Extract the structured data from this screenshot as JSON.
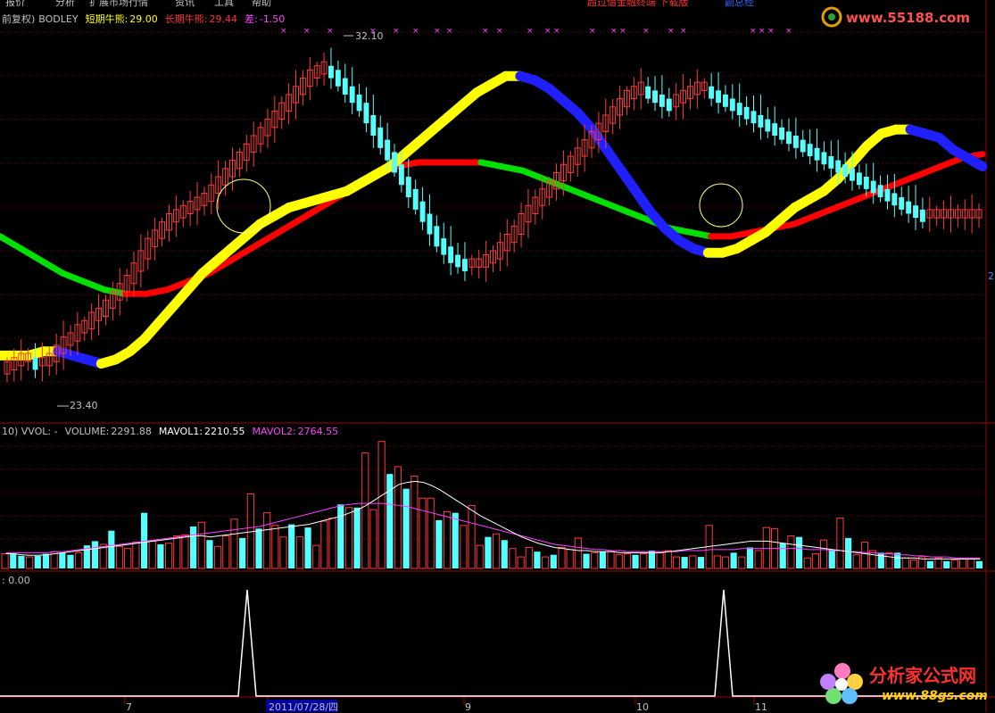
{
  "menu": {
    "items": [
      "报价",
      "分析",
      "扩展市场行情",
      "资讯",
      "工具",
      "帮助"
    ],
    "promo": "超过借金融终端 下载版",
    "promo2": "副总经"
  },
  "watermark_top": "www.55188.com",
  "watermark_bottom": {
    "cn": "分析家公式网",
    "url": "www.88gs.com"
  },
  "panels": {
    "price": {
      "label_prefix": "前复权)",
      "indicator": "BODLEY",
      "short_label": "短期牛熊:",
      "short_value": "29.00",
      "long_label": "长期牛熊:",
      "long_value": "29.44",
      "diff_label": "差:",
      "diff_value": "-1.50",
      "high_annotation": "32.10",
      "low_annotation": "23.40",
      "right_axis_label": "2"
    },
    "volume": {
      "label_prefix": "10) VVOL: -",
      "volume_label": "VOLUME:",
      "volume_value": "2291.88",
      "mavol1_label": "MAVOL1:",
      "mavol1_value": "2210.55",
      "mavol2_label": "MAVOL2:",
      "mavol2_value": "2764.55"
    },
    "signal": {
      "label": ": 0.00"
    }
  },
  "x_axis": {
    "ticks": [
      {
        "label": "7",
        "index": 0
      },
      {
        "label": "2011/07/28/四",
        "index": 27,
        "highlight": true
      },
      {
        "label": "9",
        "index": 66
      },
      {
        "label": "10",
        "index": 91
      },
      {
        "label": "11",
        "index": 108
      }
    ]
  },
  "colors": {
    "up": "#ff3b3b",
    "down": "#54ffff",
    "short_rising": "#ffff00",
    "short_falling": "#2020ff",
    "long_rising": "#ff0000",
    "long_falling": "#00e000",
    "mavol1": "#ffffff",
    "mavol2": "#ff40ff",
    "grid": "#7a0000",
    "signal": "#ffffff",
    "marker": "#ff40ff"
  },
  "chart_data": [
    {
      "type": "candlestick",
      "title": "BODLEY",
      "ylim": [
        23.0,
        32.6
      ],
      "x": [
        0,
        1,
        2,
        3,
        4,
        5,
        6,
        7,
        8,
        9,
        10,
        11,
        12,
        13,
        14,
        15,
        16,
        17,
        18,
        19,
        20,
        21,
        22,
        23,
        24,
        25,
        26,
        27,
        28,
        29,
        30,
        31,
        32,
        33,
        34,
        35,
        36,
        37,
        38,
        39,
        40,
        41,
        42,
        43,
        44,
        45,
        46,
        47,
        48,
        49,
        50,
        51,
        52,
        53,
        54,
        55,
        56,
        57,
        58,
        59,
        60,
        61,
        62,
        63,
        64,
        65,
        66,
        67,
        68,
        69,
        70,
        71,
        72,
        73,
        74,
        75,
        76,
        77,
        78,
        79,
        80,
        81,
        82,
        83,
        84,
        85,
        86,
        87,
        88,
        89,
        90,
        91,
        92,
        93,
        94,
        95,
        96,
        97,
        98,
        99,
        100,
        101,
        102,
        103,
        104,
        105,
        106,
        107,
        108,
        109,
        110,
        111,
        112,
        113,
        114,
        115,
        116,
        117,
        118,
        119,
        120,
        121,
        122,
        123,
        124,
        125,
        126,
        127,
        128,
        129,
        130,
        131,
        132,
        133,
        134,
        135,
        136,
        137,
        138
      ],
      "open": [
        24.2,
        24.3,
        24.4,
        24.5,
        24.5,
        24.4,
        24.4,
        24.5,
        24.7,
        24.9,
        25.0,
        25.2,
        25.3,
        25.5,
        25.6,
        25.8,
        26.0,
        26.2,
        26.4,
        26.7,
        27.0,
        27.3,
        27.5,
        27.7,
        27.9,
        28.0,
        28.1,
        28.2,
        28.3,
        28.4,
        28.6,
        28.8,
        29.0,
        29.2,
        29.4,
        29.6,
        29.8,
        30.0,
        30.2,
        30.4,
        30.6,
        30.8,
        31.0,
        31.2,
        31.4,
        31.5,
        31.6,
        31.5,
        31.3,
        31.1,
        30.9,
        30.7,
        30.4,
        30.1,
        29.8,
        29.5,
        29.2,
        28.9,
        28.6,
        28.3,
        28.0,
        27.7,
        27.4,
        27.2,
        27.0,
        26.9,
        26.8,
        26.8,
        26.8,
        26.9,
        27.0,
        27.2,
        27.4,
        27.6,
        27.9,
        28.1,
        28.3,
        28.5,
        28.7,
        28.9,
        29.1,
        29.3,
        29.5,
        29.7,
        29.9,
        30.1,
        30.3,
        30.5,
        30.7,
        30.9,
        31.0,
        31.1,
        31.0,
        30.9,
        30.8,
        30.7,
        30.8,
        30.9,
        31.0,
        31.1,
        31.1,
        31.0,
        30.9,
        30.8,
        30.7,
        30.6,
        30.5,
        30.4,
        30.3,
        30.2,
        30.1,
        30.0,
        29.9,
        29.8,
        29.7,
        29.6,
        29.5,
        29.4,
        29.3,
        29.2,
        29.1,
        29.0,
        28.9,
        28.8,
        28.7,
        28.6,
        28.5,
        28.4,
        28.3,
        28.2,
        28.1,
        28.0,
        28.0,
        28.0,
        28.0,
        28.0,
        28.0,
        28.0,
        28.0
      ],
      "close": [
        24.3,
        24.4,
        24.5,
        24.5,
        24.4,
        24.4,
        24.5,
        24.7,
        24.9,
        25.0,
        25.2,
        25.3,
        25.5,
        25.6,
        25.8,
        26.0,
        26.2,
        26.4,
        26.7,
        27.0,
        27.3,
        27.5,
        27.7,
        27.9,
        28.0,
        28.1,
        28.2,
        28.3,
        28.4,
        28.6,
        28.8,
        29.0,
        29.2,
        29.4,
        29.6,
        29.8,
        30.0,
        30.2,
        30.4,
        30.6,
        30.8,
        31.0,
        31.2,
        31.4,
        31.5,
        31.6,
        31.5,
        31.3,
        31.1,
        30.9,
        30.7,
        30.4,
        30.1,
        29.8,
        29.5,
        29.2,
        28.9,
        28.6,
        28.3,
        28.0,
        27.7,
        27.4,
        27.2,
        27.0,
        26.9,
        26.8,
        26.8,
        26.8,
        26.9,
        27.0,
        27.2,
        27.4,
        27.6,
        27.9,
        28.1,
        28.3,
        28.5,
        28.7,
        28.9,
        29.1,
        29.3,
        29.5,
        29.7,
        29.9,
        30.1,
        30.3,
        30.5,
        30.7,
        30.9,
        31.0,
        31.1,
        31.0,
        30.9,
        30.8,
        30.7,
        30.8,
        30.9,
        31.0,
        31.1,
        31.1,
        31.0,
        30.9,
        30.8,
        30.7,
        30.6,
        30.5,
        30.4,
        30.3,
        30.2,
        30.1,
        30.0,
        29.9,
        29.8,
        29.7,
        29.6,
        29.5,
        29.4,
        29.3,
        29.2,
        29.1,
        29.0,
        28.9,
        28.8,
        28.7,
        28.6,
        28.5,
        28.4,
        28.3,
        28.2,
        28.1,
        28.0,
        28.0,
        28.0,
        28.0,
        28.0,
        28.0,
        28.0,
        28.0,
        28.0
      ],
      "series_lines": {
        "short": [
          24.6,
          24.6,
          24.6,
          24.7,
          24.7,
          24.6,
          24.5,
          24.4,
          24.5,
          24.7,
          25.0,
          25.4,
          25.8,
          26.2,
          26.6,
          26.9,
          27.2,
          27.5,
          27.8,
          28.0,
          28.2,
          28.3,
          28.4,
          28.5,
          28.6,
          28.8,
          29.0,
          29.2,
          29.5,
          29.8,
          30.1,
          30.4,
          30.7,
          31.0,
          31.2,
          31.4,
          31.4,
          31.3,
          31.1,
          30.8,
          30.5,
          30.1,
          29.6,
          29.1,
          28.6,
          28.1,
          27.7,
          27.4,
          27.2,
          27.1,
          27.1,
          27.2,
          27.4,
          27.6,
          27.9,
          28.2,
          28.4,
          28.6,
          28.9,
          29.3,
          29.7,
          30.0,
          30.1,
          30.1,
          30.0,
          29.9,
          29.6,
          29.4,
          29.2
        ],
        "long": [
          27.5,
          27.2,
          26.9,
          26.6,
          26.4,
          26.2,
          26.1,
          26.1,
          26.2,
          26.4,
          26.6,
          26.9,
          27.2,
          27.5,
          27.8,
          28.1,
          28.4,
          28.7,
          29.0,
          29.2,
          29.3,
          29.3,
          29.3,
          29.3,
          29.2,
          29.1,
          28.9,
          28.7,
          28.5,
          28.3,
          28.1,
          27.9,
          27.7,
          27.6,
          27.5,
          27.5,
          27.6,
          27.7,
          27.8,
          28.0,
          28.2,
          28.4,
          28.6,
          28.8,
          29.0,
          29.2,
          29.4,
          29.5
        ]
      }
    },
    {
      "type": "bar",
      "title": "VVOL",
      "series": [
        {
          "name": "VOLUME"
        },
        {
          "name": "MAVOL1"
        },
        {
          "name": "MAVOL2"
        }
      ],
      "values": [
        1400,
        1400,
        1200,
        1100,
        1200,
        1400,
        1600,
        1500,
        1300,
        1500,
        2200,
        2600,
        2300,
        3600,
        2100,
        1900,
        2500,
        5300,
        2600,
        2300,
        2400,
        3100,
        3200,
        4000,
        4400,
        2700,
        2100,
        3100,
        4700,
        2900,
        7100,
        3800,
        5300,
        4100,
        3000,
        4200,
        3000,
        3900,
        2200,
        4500,
        4800,
        6100,
        5800,
        5800,
        11000,
        5600,
        12100,
        9000,
        9700,
        7600,
        8800,
        6700,
        6700,
        4600,
        5400,
        5300,
        4100,
        6000,
        2200,
        3000,
        3300,
        2700,
        1900,
        1100,
        2000,
        1600,
        1100,
        1300,
        2000,
        1800,
        2900,
        1400,
        1500,
        1600,
        1600,
        1300,
        1400,
        1300,
        1400,
        1700,
        1500,
        1700,
        1100,
        1100,
        1200,
        1100,
        4100,
        1200,
        1100,
        1500,
        1100,
        2000,
        1700,
        3900,
        3800,
        2400,
        3100,
        3000,
        1000,
        1400,
        2700,
        1800,
        4800,
        2900,
        1300,
        2500,
        1700,
        1500,
        1500,
        1500,
        1000,
        800,
        1100,
        700,
        1000,
        700,
        800,
        900,
        900,
        700
      ],
      "mavol1": [
        1400,
        1400,
        1300,
        1250,
        1260,
        1300,
        1400,
        1500,
        1600,
        1700,
        1800,
        1900,
        2000,
        2100,
        2200,
        2300,
        2400,
        2500,
        2600,
        2700,
        2800,
        2900,
        3000,
        3100,
        3100,
        3000,
        3100,
        3200,
        3300,
        3400,
        3500,
        3600,
        3700,
        3800,
        3900,
        4000,
        4100,
        4200,
        4400,
        4600,
        4800,
        5000,
        5300,
        5600,
        6000,
        6500,
        7000,
        7500,
        8000,
        8200,
        8300,
        8200,
        7900,
        7500,
        7000,
        6500,
        6000,
        5500,
        5000,
        4600,
        4200,
        3800,
        3400,
        3000,
        2700,
        2400,
        2200,
        2000,
        1900,
        1800,
        1700,
        1700,
        1600,
        1600,
        1600,
        1500,
        1500,
        1500,
        1500,
        1500,
        1500,
        1600,
        1700,
        1800,
        1900,
        2000,
        2100,
        2200,
        2300,
        2400,
        2500,
        2600,
        2600,
        2600,
        2500,
        2400,
        2300,
        2200,
        2100,
        2000,
        1900,
        1800,
        1700,
        1600,
        1500,
        1400,
        1300,
        1200,
        1100,
        1000,
        1000,
        1000,
        900,
        900,
        900,
        900,
        900,
        900,
        900,
        900
      ],
      "mavol2": [
        1500,
        1500,
        1500,
        1500,
        1500,
        1500,
        1600,
        1600,
        1700,
        1800,
        1900,
        2000,
        2100,
        2200,
        2300,
        2400,
        2500,
        2600,
        2700,
        2800,
        2900,
        3000,
        3100,
        3200,
        3300,
        3400,
        3500,
        3600,
        3700,
        3800,
        3900,
        4000,
        4200,
        4400,
        4600,
        4800,
        5000,
        5200,
        5400,
        5600,
        5800,
        6000,
        6100,
        6200,
        6200,
        6200,
        6200,
        6100,
        6000,
        5900,
        5700,
        5500,
        5300,
        5100,
        4900,
        4700,
        4500,
        4300,
        4100,
        3900,
        3700,
        3500,
        3300,
        3100,
        2900,
        2700,
        2500,
        2300,
        2200,
        2100,
        2000,
        1900,
        1800,
        1800,
        1700,
        1700,
        1600,
        1600,
        1600,
        1600,
        1600,
        1600,
        1600,
        1700,
        1700,
        1700,
        1800,
        1800,
        1800,
        1800,
        1900,
        1900,
        1900,
        1900,
        1900,
        1900,
        1900,
        1900,
        1800,
        1800,
        1800,
        1700,
        1700,
        1600,
        1600,
        1500,
        1500,
        1400,
        1400,
        1300,
        1300,
        1200,
        1200,
        1100,
        1100,
        1100,
        1000,
        1000,
        1000,
        1000
      ]
    },
    {
      "type": "line",
      "title": "signal",
      "spikes_at_index": [
        33,
        121
      ],
      "ylim": [
        0,
        1
      ]
    }
  ]
}
